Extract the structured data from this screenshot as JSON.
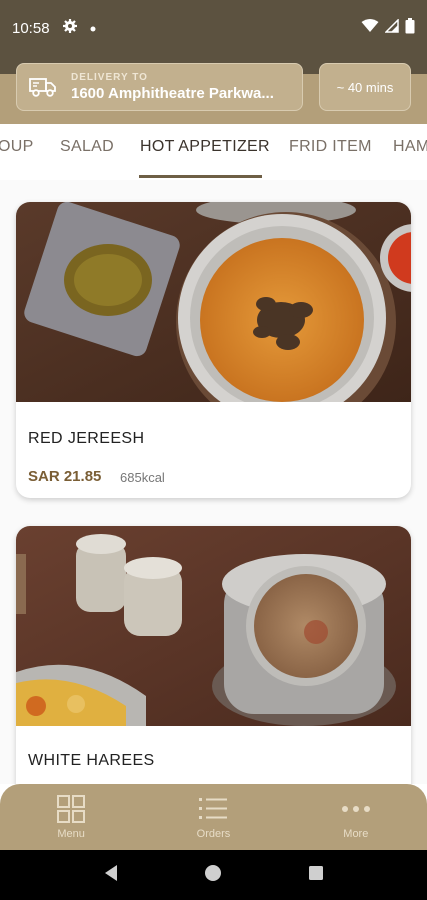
{
  "status_bar": {
    "time": "10:58",
    "icons": [
      "gear-icon",
      "dot-icon",
      "wifi-icon",
      "signal-icon",
      "battery-icon"
    ]
  },
  "delivery": {
    "label": "DELIVERY TO",
    "address": "1600 Amphitheatre Parkwa...",
    "eta": "~ 40 mins",
    "icon": "truck-icon"
  },
  "tabs": [
    {
      "label": "OUP"
    },
    {
      "label": "SALAD"
    },
    {
      "label": "HOT APPETIZER",
      "active": true
    },
    {
      "label": "FRID ITEM"
    },
    {
      "label": "HAM"
    }
  ],
  "items": [
    {
      "name": "RED JEREESH",
      "price": "SAR 21.85",
      "kcal": "685kcal"
    },
    {
      "name": "WHITE HAREES",
      "price": "",
      "kcal": ""
    }
  ],
  "bottom_nav": [
    {
      "label": "Menu",
      "icon": "grid-icon"
    },
    {
      "label": "Orders",
      "icon": "list-icon"
    },
    {
      "label": "More",
      "icon": "more-icon"
    }
  ],
  "colors": {
    "brand_dark": "#5c5240",
    "brand": "#b39f7a",
    "price": "#7a5e35"
  }
}
